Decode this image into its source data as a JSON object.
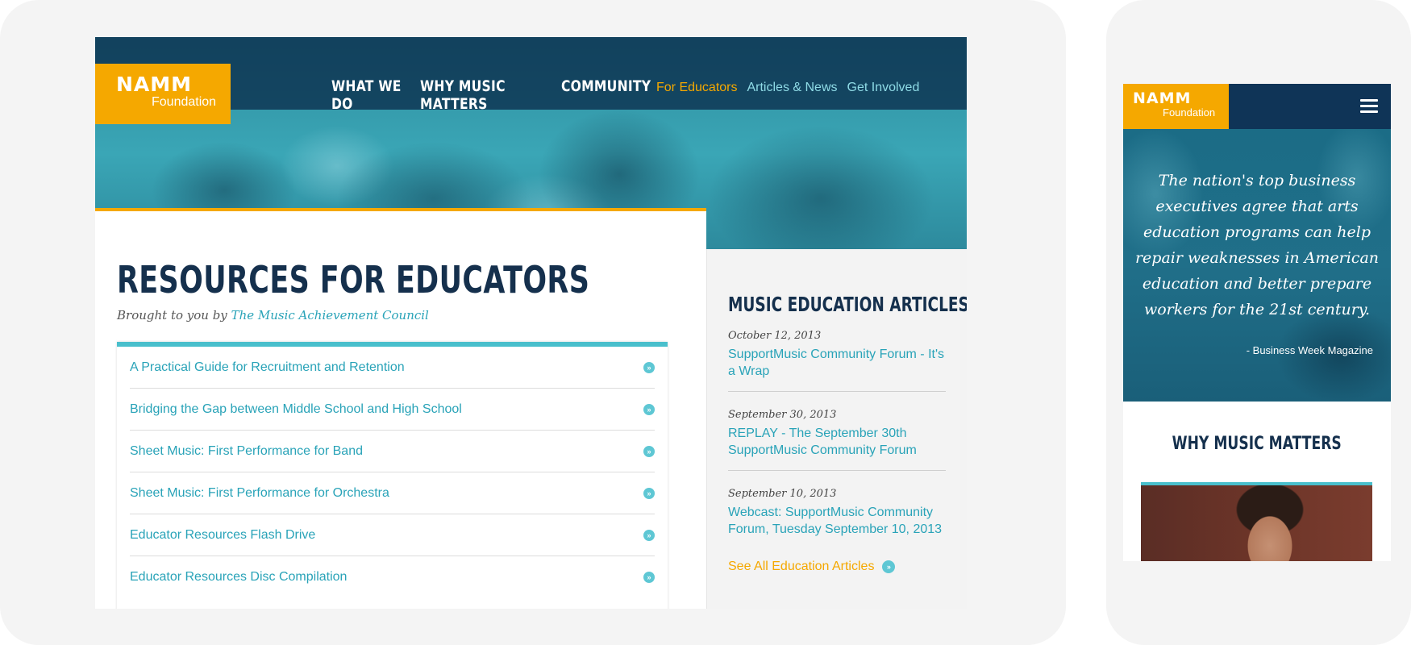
{
  "brand": {
    "logo_main": "NAMM",
    "logo_sub": "Foundation"
  },
  "nav": {
    "primary": [
      "WHAT WE DO",
      "WHY MUSIC MATTERS",
      "COMMUNITY"
    ],
    "secondary": [
      "For Educators",
      "Articles & News",
      "Get Involved"
    ],
    "active": "For Educators"
  },
  "main": {
    "title": "RESOURCES FOR EDUCATORS",
    "byline_prefix": "Brought to you by",
    "byline_link": "The Music Achievement Council",
    "resources": [
      "A Practical Guide for Recruitment and Retention",
      "Bridging the Gap between Middle School and High School",
      "Sheet Music: First Performance for Band",
      "Sheet Music: First Performance for Orchestra",
      "Educator Resources Flash Drive",
      "Educator Resources Disc Compilation"
    ]
  },
  "sidebar": {
    "title": "MUSIC EDUCATION ARTICLES",
    "articles": [
      {
        "date": "October 12, 2013",
        "title": "SupportMusic Community Forum - It's a Wrap"
      },
      {
        "date": "September 30, 2013",
        "title": "REPLAY - The September 30th SupportMusic Community Forum"
      },
      {
        "date": "September 10, 2013",
        "title": "Webcast: SupportMusic Community Forum, Tuesday September 10, 2013"
      }
    ],
    "see_all": "See All Education Articles"
  },
  "mobile": {
    "quote": "The nation's top business executives agree that arts education programs can help repair weaknesses in American education and better prepare workers for the 21st century.",
    "quote_source": "- Business Week Magazine",
    "section_title": "WHY MUSIC MATTERS"
  },
  "colors": {
    "navy": "#15304d",
    "gold": "#f5a800",
    "teal": "#29a3b8",
    "light_teal": "#49bfcc"
  },
  "icons": [
    "chevron-right-circle-icon",
    "hamburger-menu-icon"
  ]
}
